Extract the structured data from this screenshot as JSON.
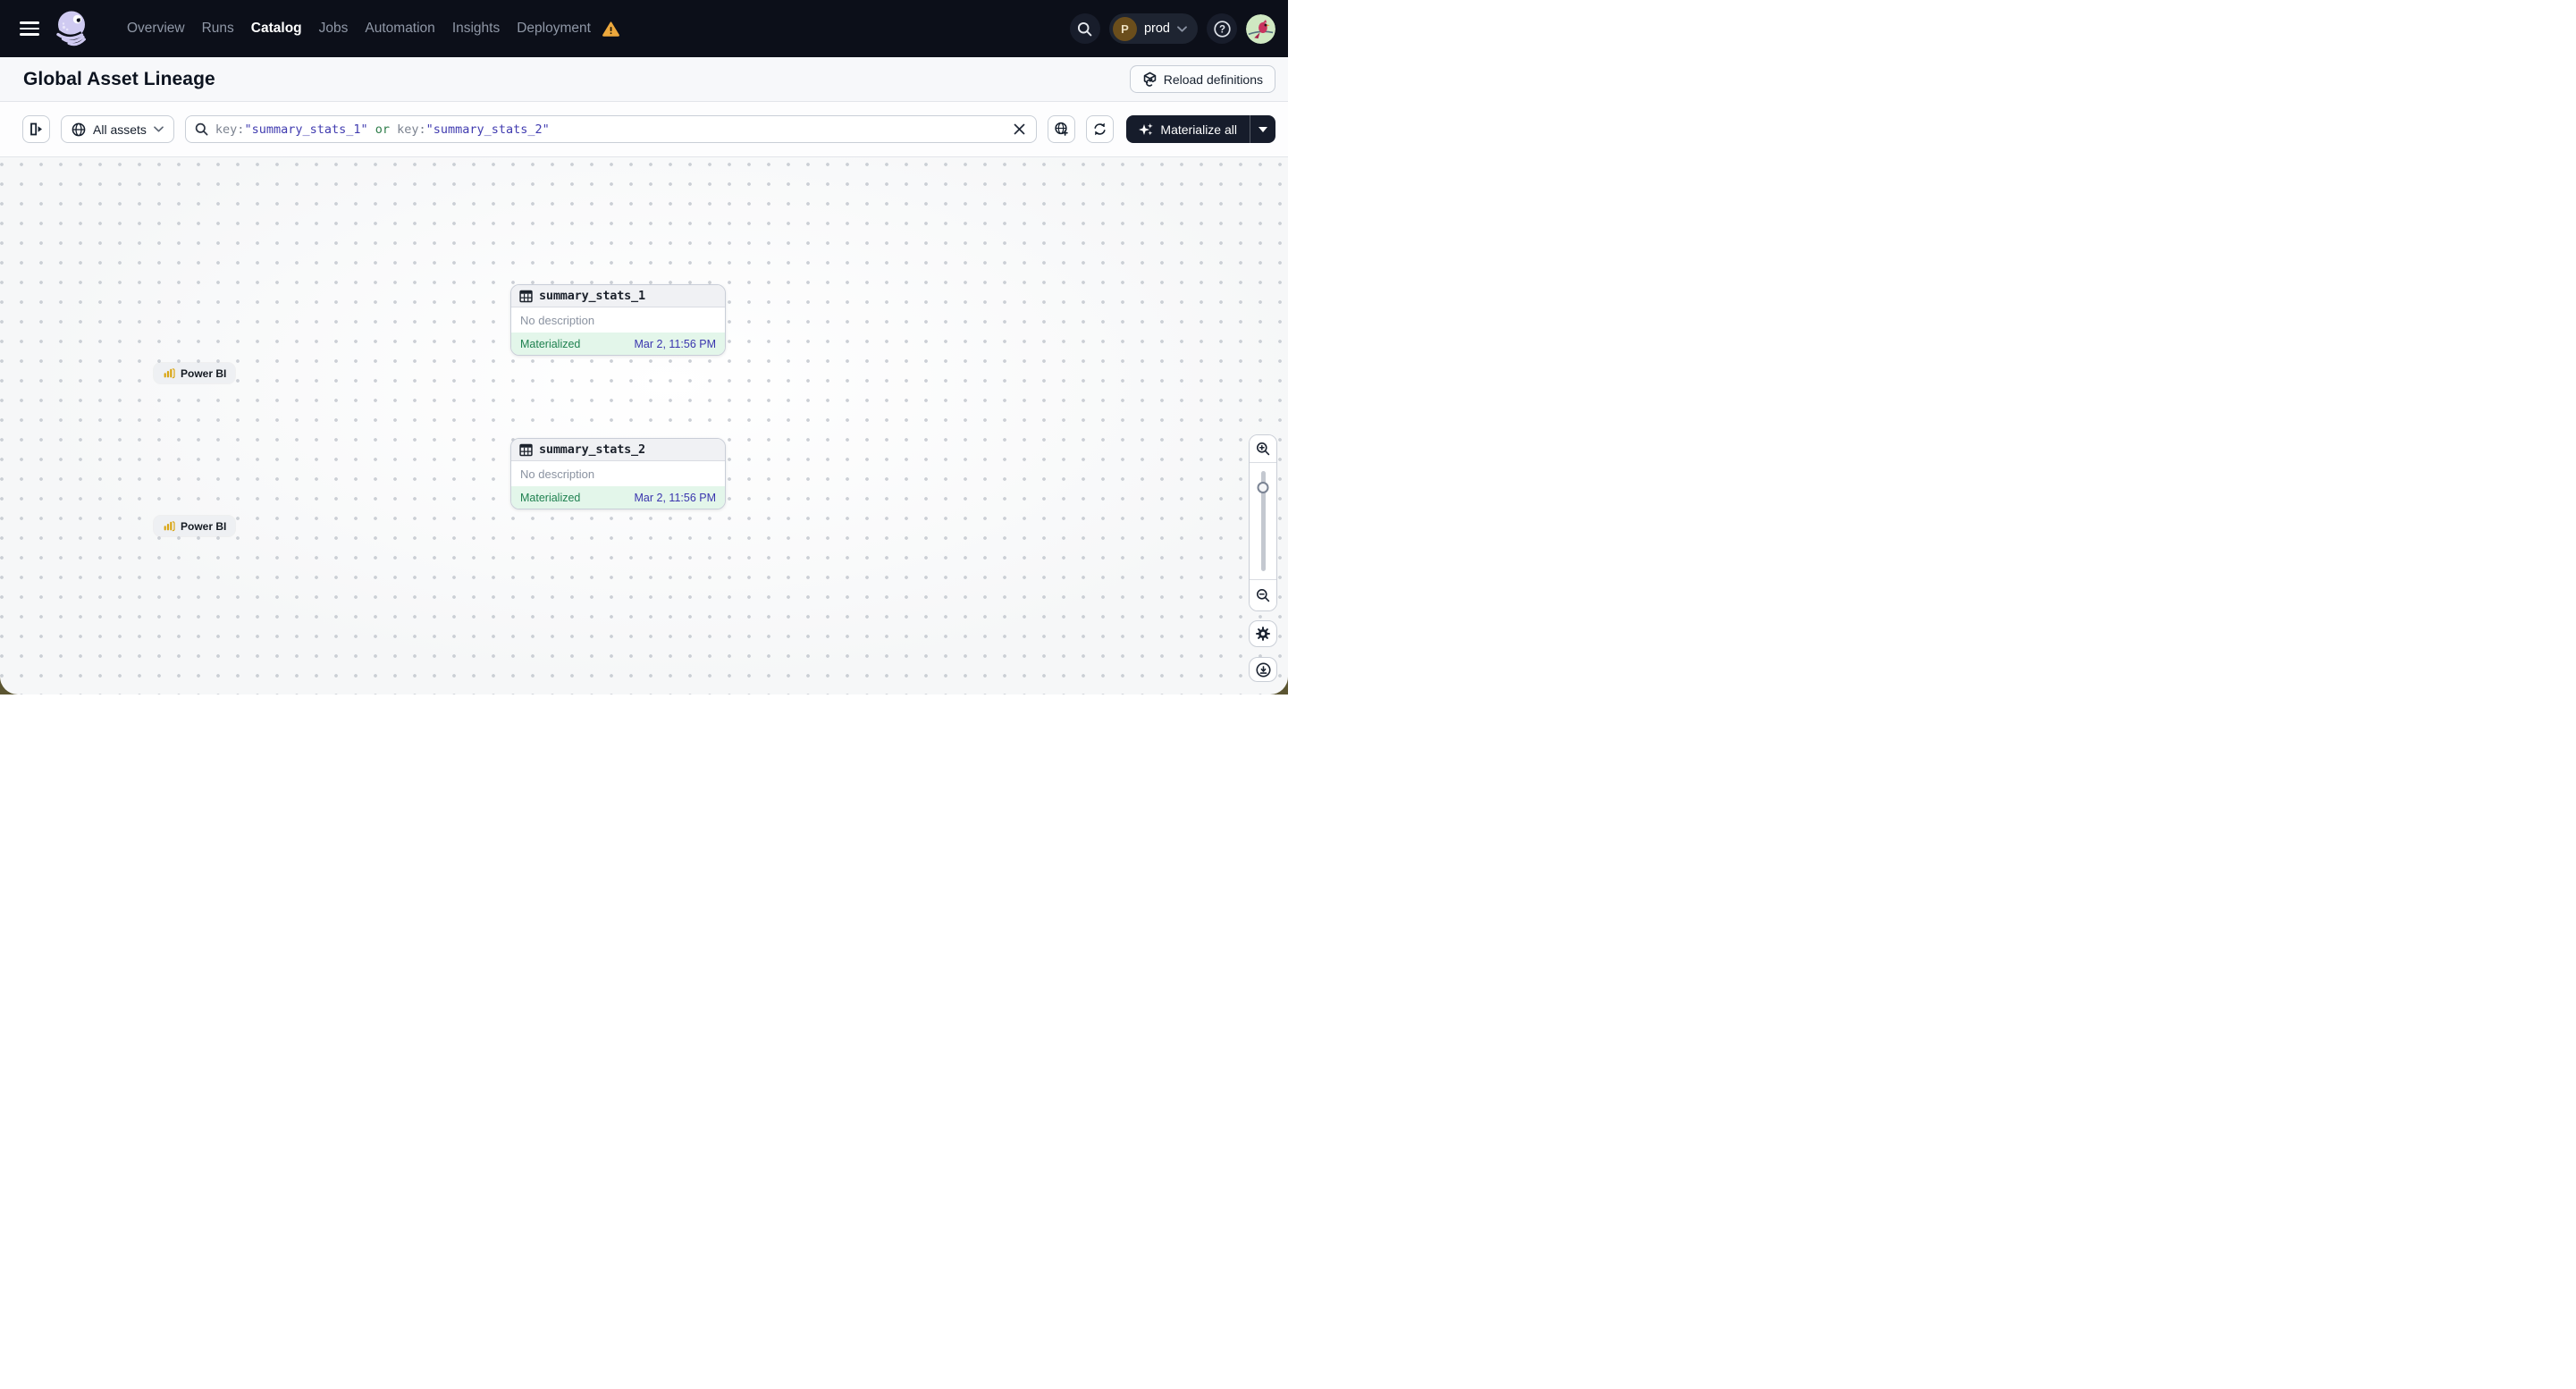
{
  "nav": {
    "items": [
      {
        "label": "Overview"
      },
      {
        "label": "Runs"
      },
      {
        "label": "Catalog",
        "active": true
      },
      {
        "label": "Jobs"
      },
      {
        "label": "Automation"
      },
      {
        "label": "Insights"
      },
      {
        "label": "Deployment",
        "warning": true
      }
    ],
    "environment": {
      "initial": "P",
      "label": "prod"
    },
    "help_glyph": "?"
  },
  "header": {
    "title": "Global Asset Lineage",
    "reload_button_label": "Reload definitions"
  },
  "toolbar": {
    "asset_filter_label": "All assets",
    "search": {
      "key1": "key:",
      "value1": "\"summary_stats_1\"",
      "operator": " or ",
      "key2": "key:",
      "value2": "\"summary_stats_2\""
    },
    "clear_glyph": "✕",
    "materialize_button_label": "Materialize all"
  },
  "graph": {
    "nodes": [
      {
        "title": "summary_stats_1",
        "description": "No description",
        "status": "Materialized",
        "materialized_at": "Mar 2, 11:56 PM",
        "tag": "Power BI"
      },
      {
        "title": "summary_stats_2",
        "description": "No description",
        "status": "Materialized",
        "materialized_at": "Mar 2, 11:56 PM",
        "tag": "Power BI"
      }
    ]
  },
  "colors": {
    "nav_bg": "#0c0f19",
    "accent_indigo": "#413cb0",
    "status_green": "#1f8150",
    "status_green_bg": "#e3f6ea",
    "warning_amber": "#eda83d",
    "corner_olive": "#5b5531",
    "powerbi_gold": "#d9a512"
  }
}
